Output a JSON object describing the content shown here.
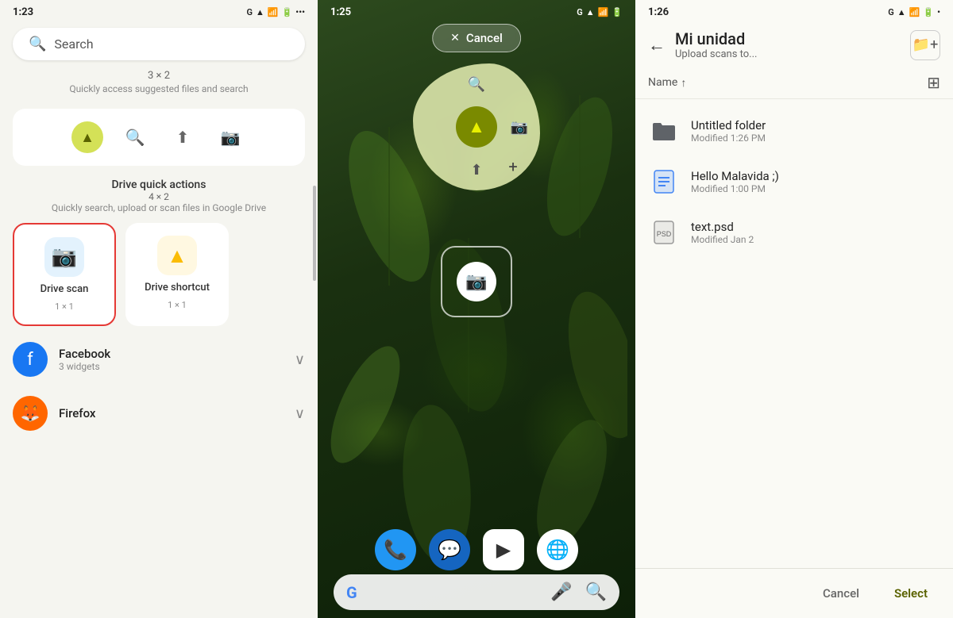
{
  "panel1": {
    "status_time": "1:23",
    "search_placeholder": "Search",
    "widget_1_grid": "3 × 2",
    "widget_1_desc": "Quickly access suggested files and search",
    "drive_quick_title": "Drive quick actions",
    "drive_quick_grid": "4 × 2",
    "drive_quick_desc": "Quickly search, upload or scan files in Google Drive",
    "widget_scan_label": "Drive scan",
    "widget_scan_size": "1 × 1",
    "widget_shortcut_label": "Drive shortcut",
    "widget_shortcut_size": "1 × 1",
    "app_facebook_name": "Facebook",
    "app_facebook_widgets": "3 widgets",
    "app_firefox_name": "Firefox",
    "app_firefox_widgets": ""
  },
  "panel2": {
    "status_time": "1:25",
    "cancel_label": "Cancel",
    "plus_label": "+",
    "search_placeholder": "Search"
  },
  "panel3": {
    "status_time": "1:26",
    "back_icon": "←",
    "title": "Mi unidad",
    "subtitle": "Upload scans to...",
    "sort_label": "Name",
    "sort_arrow": "↑",
    "new_folder_icon": "⊞",
    "files": [
      {
        "icon": "📁",
        "icon_type": "folder",
        "name": "Untitled folder",
        "modified": "Modified 1:26 PM"
      },
      {
        "icon": "📄",
        "icon_type": "doc",
        "name": "Hello Malavida ;)",
        "modified": "Modified 1:00 PM"
      },
      {
        "icon": "🖼",
        "icon_type": "psd",
        "name": "text.psd",
        "modified": "Modified Jan 2"
      }
    ],
    "cancel_label": "Cancel",
    "select_label": "Select"
  }
}
